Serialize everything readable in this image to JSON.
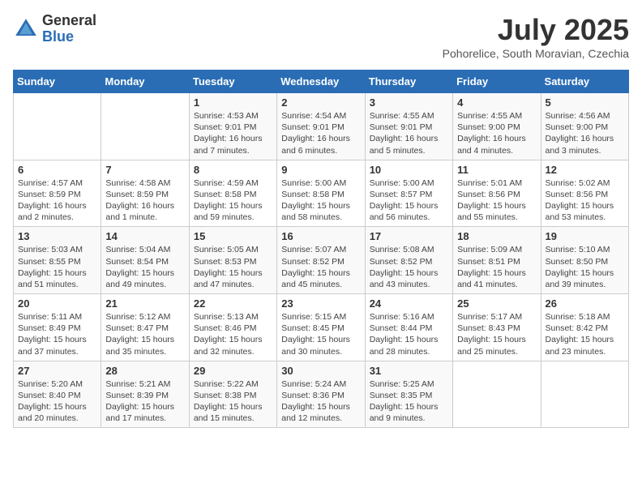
{
  "logo": {
    "general": "General",
    "blue": "Blue"
  },
  "title": "July 2025",
  "subtitle": "Pohorelice, South Moravian, Czechia",
  "days_of_week": [
    "Sunday",
    "Monday",
    "Tuesday",
    "Wednesday",
    "Thursday",
    "Friday",
    "Saturday"
  ],
  "weeks": [
    [
      {
        "day": "",
        "info": ""
      },
      {
        "day": "",
        "info": ""
      },
      {
        "day": "1",
        "info": "Sunrise: 4:53 AM\nSunset: 9:01 PM\nDaylight: 16 hours and 7 minutes."
      },
      {
        "day": "2",
        "info": "Sunrise: 4:54 AM\nSunset: 9:01 PM\nDaylight: 16 hours and 6 minutes."
      },
      {
        "day": "3",
        "info": "Sunrise: 4:55 AM\nSunset: 9:01 PM\nDaylight: 16 hours and 5 minutes."
      },
      {
        "day": "4",
        "info": "Sunrise: 4:55 AM\nSunset: 9:00 PM\nDaylight: 16 hours and 4 minutes."
      },
      {
        "day": "5",
        "info": "Sunrise: 4:56 AM\nSunset: 9:00 PM\nDaylight: 16 hours and 3 minutes."
      }
    ],
    [
      {
        "day": "6",
        "info": "Sunrise: 4:57 AM\nSunset: 8:59 PM\nDaylight: 16 hours and 2 minutes."
      },
      {
        "day": "7",
        "info": "Sunrise: 4:58 AM\nSunset: 8:59 PM\nDaylight: 16 hours and 1 minute."
      },
      {
        "day": "8",
        "info": "Sunrise: 4:59 AM\nSunset: 8:58 PM\nDaylight: 15 hours and 59 minutes."
      },
      {
        "day": "9",
        "info": "Sunrise: 5:00 AM\nSunset: 8:58 PM\nDaylight: 15 hours and 58 minutes."
      },
      {
        "day": "10",
        "info": "Sunrise: 5:00 AM\nSunset: 8:57 PM\nDaylight: 15 hours and 56 minutes."
      },
      {
        "day": "11",
        "info": "Sunrise: 5:01 AM\nSunset: 8:56 PM\nDaylight: 15 hours and 55 minutes."
      },
      {
        "day": "12",
        "info": "Sunrise: 5:02 AM\nSunset: 8:56 PM\nDaylight: 15 hours and 53 minutes."
      }
    ],
    [
      {
        "day": "13",
        "info": "Sunrise: 5:03 AM\nSunset: 8:55 PM\nDaylight: 15 hours and 51 minutes."
      },
      {
        "day": "14",
        "info": "Sunrise: 5:04 AM\nSunset: 8:54 PM\nDaylight: 15 hours and 49 minutes."
      },
      {
        "day": "15",
        "info": "Sunrise: 5:05 AM\nSunset: 8:53 PM\nDaylight: 15 hours and 47 minutes."
      },
      {
        "day": "16",
        "info": "Sunrise: 5:07 AM\nSunset: 8:52 PM\nDaylight: 15 hours and 45 minutes."
      },
      {
        "day": "17",
        "info": "Sunrise: 5:08 AM\nSunset: 8:52 PM\nDaylight: 15 hours and 43 minutes."
      },
      {
        "day": "18",
        "info": "Sunrise: 5:09 AM\nSunset: 8:51 PM\nDaylight: 15 hours and 41 minutes."
      },
      {
        "day": "19",
        "info": "Sunrise: 5:10 AM\nSunset: 8:50 PM\nDaylight: 15 hours and 39 minutes."
      }
    ],
    [
      {
        "day": "20",
        "info": "Sunrise: 5:11 AM\nSunset: 8:49 PM\nDaylight: 15 hours and 37 minutes."
      },
      {
        "day": "21",
        "info": "Sunrise: 5:12 AM\nSunset: 8:47 PM\nDaylight: 15 hours and 35 minutes."
      },
      {
        "day": "22",
        "info": "Sunrise: 5:13 AM\nSunset: 8:46 PM\nDaylight: 15 hours and 32 minutes."
      },
      {
        "day": "23",
        "info": "Sunrise: 5:15 AM\nSunset: 8:45 PM\nDaylight: 15 hours and 30 minutes."
      },
      {
        "day": "24",
        "info": "Sunrise: 5:16 AM\nSunset: 8:44 PM\nDaylight: 15 hours and 28 minutes."
      },
      {
        "day": "25",
        "info": "Sunrise: 5:17 AM\nSunset: 8:43 PM\nDaylight: 15 hours and 25 minutes."
      },
      {
        "day": "26",
        "info": "Sunrise: 5:18 AM\nSunset: 8:42 PM\nDaylight: 15 hours and 23 minutes."
      }
    ],
    [
      {
        "day": "27",
        "info": "Sunrise: 5:20 AM\nSunset: 8:40 PM\nDaylight: 15 hours and 20 minutes."
      },
      {
        "day": "28",
        "info": "Sunrise: 5:21 AM\nSunset: 8:39 PM\nDaylight: 15 hours and 17 minutes."
      },
      {
        "day": "29",
        "info": "Sunrise: 5:22 AM\nSunset: 8:38 PM\nDaylight: 15 hours and 15 minutes."
      },
      {
        "day": "30",
        "info": "Sunrise: 5:24 AM\nSunset: 8:36 PM\nDaylight: 15 hours and 12 minutes."
      },
      {
        "day": "31",
        "info": "Sunrise: 5:25 AM\nSunset: 8:35 PM\nDaylight: 15 hours and 9 minutes."
      },
      {
        "day": "",
        "info": ""
      },
      {
        "day": "",
        "info": ""
      }
    ]
  ]
}
